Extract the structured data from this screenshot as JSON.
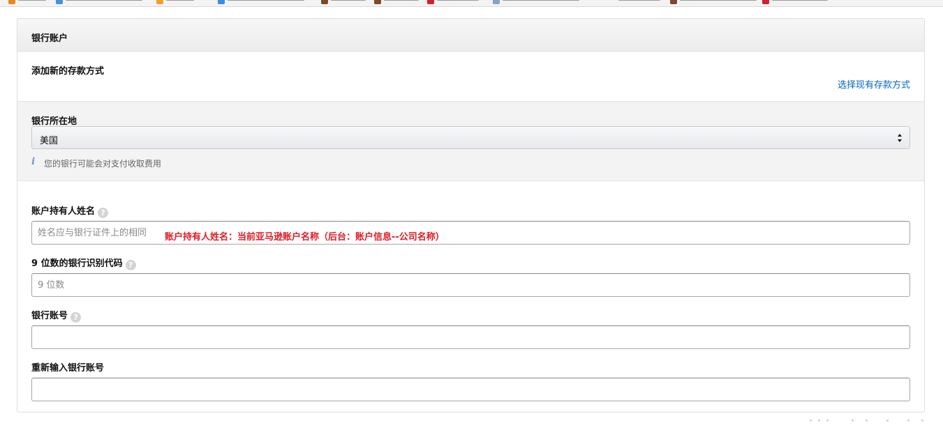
{
  "panel": {
    "title": "银行账户",
    "add_section_title": "添加新的存款方式",
    "select_existing_link": "选择现有存款方式"
  },
  "country": {
    "label": "银行所在地",
    "selected": "美国",
    "info_text": "您的银行可能会对支付收取费用"
  },
  "fields": {
    "holder_name": {
      "label": "账户持有人姓名",
      "placeholder": "姓名应与银行证件上的相同",
      "value": ""
    },
    "routing": {
      "label": "9 位数的银行识别代码",
      "placeholder": "9 位数",
      "value": ""
    },
    "account": {
      "label": "银行账号",
      "value": ""
    },
    "account_confirm": {
      "label": "重新输入银行账号",
      "value": ""
    }
  },
  "annotation": "账户持有人姓名：当前亚马逊账户名称（后台：账户信息--公司名称）",
  "colors": {
    "link": "#0066c0",
    "annotation": "#e01b24",
    "header_bg": "#ececec",
    "country_bg": "#f3f3f3"
  },
  "icons": {
    "help": "question-circle-icon",
    "info": "info-icon",
    "select_arrows": "up-down-arrows-icon"
  }
}
